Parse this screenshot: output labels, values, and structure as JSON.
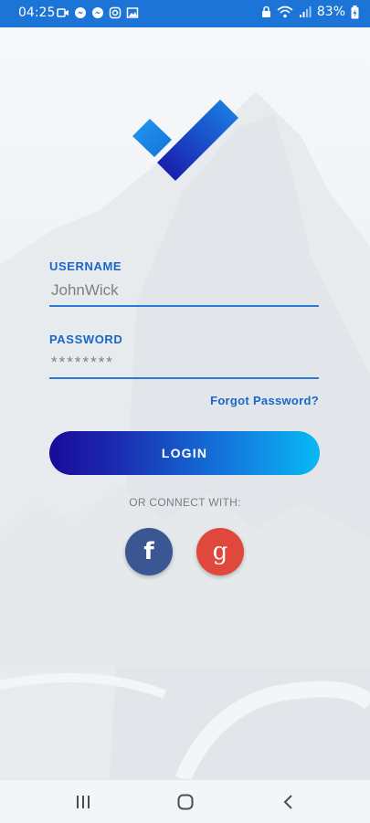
{
  "status_bar": {
    "time": "04:25",
    "battery_percent": "83%",
    "notification_icons": [
      "video-icon",
      "messenger-icon",
      "messenger-icon",
      "instagram-icon",
      "image-icon"
    ],
    "status_icons": [
      "lock-icon",
      "wifi-icon",
      "signal-icon",
      "battery-charging-icon"
    ]
  },
  "logo": {
    "icon": "checkmark-logo-icon",
    "colors": [
      "#1c8ee8",
      "#1a16b0"
    ]
  },
  "form": {
    "username_label": "USERNAME",
    "username_value": "JohnWick",
    "password_label": "PASSWORD",
    "password_value": "********",
    "forgot_password": "Forgot Password?",
    "login_button": "LOGIN"
  },
  "social": {
    "connect_text": "OR CONNECT WITH:",
    "facebook_glyph": "f",
    "google_glyph": "g",
    "facebook_color": "#3a5794",
    "google_color": "#e0473d"
  },
  "nav_bar": {
    "buttons": [
      "recent-apps-icon",
      "home-icon",
      "back-icon"
    ]
  },
  "colors": {
    "accent": "#1b66c9",
    "status_bar": "#1c74d6"
  }
}
